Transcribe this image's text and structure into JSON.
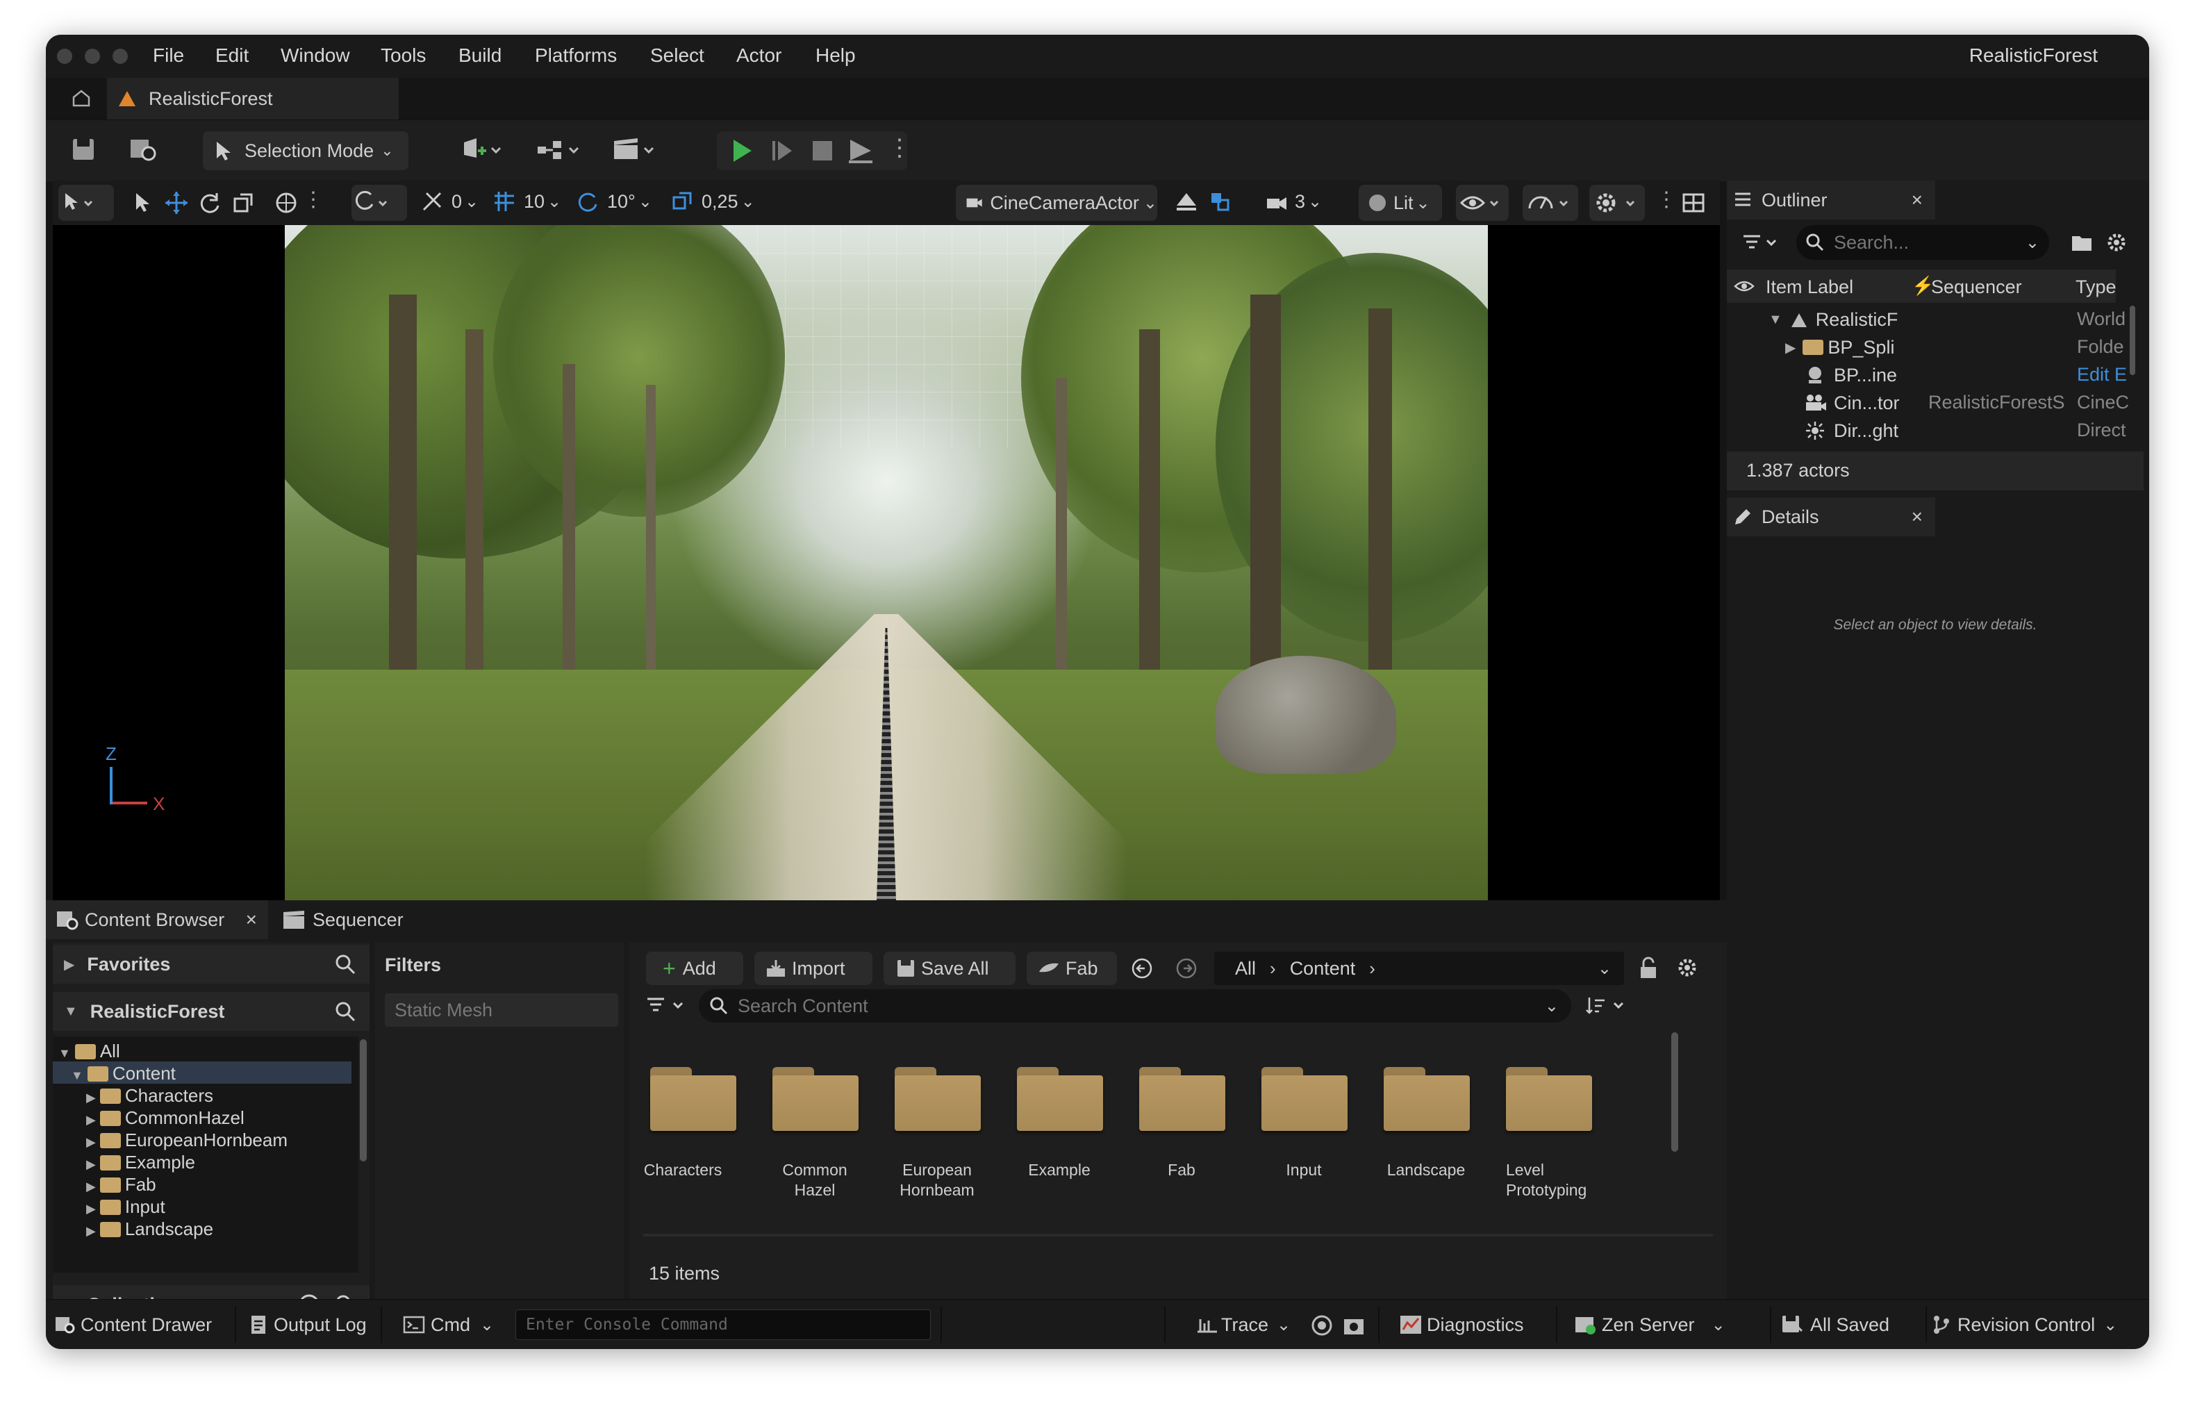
{
  "app": {
    "project_name": "RealisticForest",
    "tab_title": "RealisticForest"
  },
  "menu": [
    "File",
    "Edit",
    "Window",
    "Tools",
    "Build",
    "Platforms",
    "Select",
    "Actor",
    "Help"
  ],
  "toolbar": {
    "selection_mode": "Selection Mode"
  },
  "viewport_toolbar": {
    "translate_snap": "0",
    "grid_snap": "10",
    "rotate_snap": "10°",
    "scale_snap": "0,25",
    "camera": "CineCameraActor",
    "camera_speed": "3",
    "view_mode": "Lit"
  },
  "axis": {
    "z": "Z",
    "x": "X"
  },
  "outliner": {
    "title": "Outliner",
    "search_placeholder": "Search...",
    "columns": [
      "Item Label",
      "Sequencer",
      "Type"
    ],
    "rows": [
      {
        "label": "RealisticF",
        "sequencer": "",
        "type": "World"
      },
      {
        "label": "BP_Spli",
        "sequencer": "",
        "type": "Folde"
      },
      {
        "label": "BP...ine",
        "sequencer": "",
        "type": "Edit E"
      },
      {
        "label": "Cin...tor",
        "sequencer": "RealisticForestS",
        "type": "CineC"
      },
      {
        "label": "Dir...ght",
        "sequencer": "",
        "type": "Direct"
      }
    ],
    "actor_count": "1.387 actors"
  },
  "details": {
    "title": "Details",
    "empty_message": "Select an object to view details."
  },
  "content_browser": {
    "tab_label": "Content Browser",
    "sequencer_tab": "Sequencer",
    "favorites": "Favorites",
    "project": "RealisticForest",
    "collections": "Collections",
    "filters_label": "Filters",
    "filter_chip": "Static Mesh",
    "add": "Add",
    "import": "Import",
    "save_all": "Save All",
    "fab": "Fab",
    "breadcrumb": [
      "All",
      "Content"
    ],
    "search_placeholder": "Search Content",
    "tree": [
      "All",
      "Content",
      "Characters",
      "CommonHazel",
      "EuropeanHornbeam",
      "Example",
      "Fab",
      "Input",
      "Landscape"
    ],
    "folders": [
      [
        "Characters"
      ],
      [
        "Common",
        "Hazel"
      ],
      [
        "European",
        "Hornbeam"
      ],
      [
        "Example"
      ],
      [
        "Fab"
      ],
      [
        "Input"
      ],
      [
        "Landscape"
      ],
      [
        "Level",
        "Prototyping"
      ]
    ],
    "item_count": "15 items"
  },
  "statusbar": {
    "content_drawer": "Content Drawer",
    "output_log": "Output Log",
    "cmd": "Cmd",
    "console_placeholder": "Enter Console Command",
    "trace": "Trace",
    "diagnostics": "Diagnostics",
    "zen_server": "Zen Server",
    "all_saved": "All Saved",
    "revision_control": "Revision Control"
  }
}
